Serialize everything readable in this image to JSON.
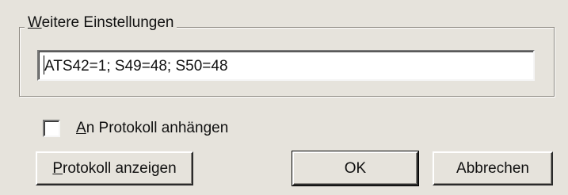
{
  "group": {
    "title_mnemonic": "W",
    "title_rest": "eitere Einstellungen",
    "input_value": "ATS42=1; S49=48; S50=48"
  },
  "checkbox": {
    "label_mnemonic": "A",
    "label_rest": "n Protokoll anhängen",
    "checked": false
  },
  "buttons": {
    "show_log_mnemonic": "P",
    "show_log_rest": "rotokoll anzeigen",
    "ok_label": "OK",
    "cancel_label": "Abbrechen"
  }
}
